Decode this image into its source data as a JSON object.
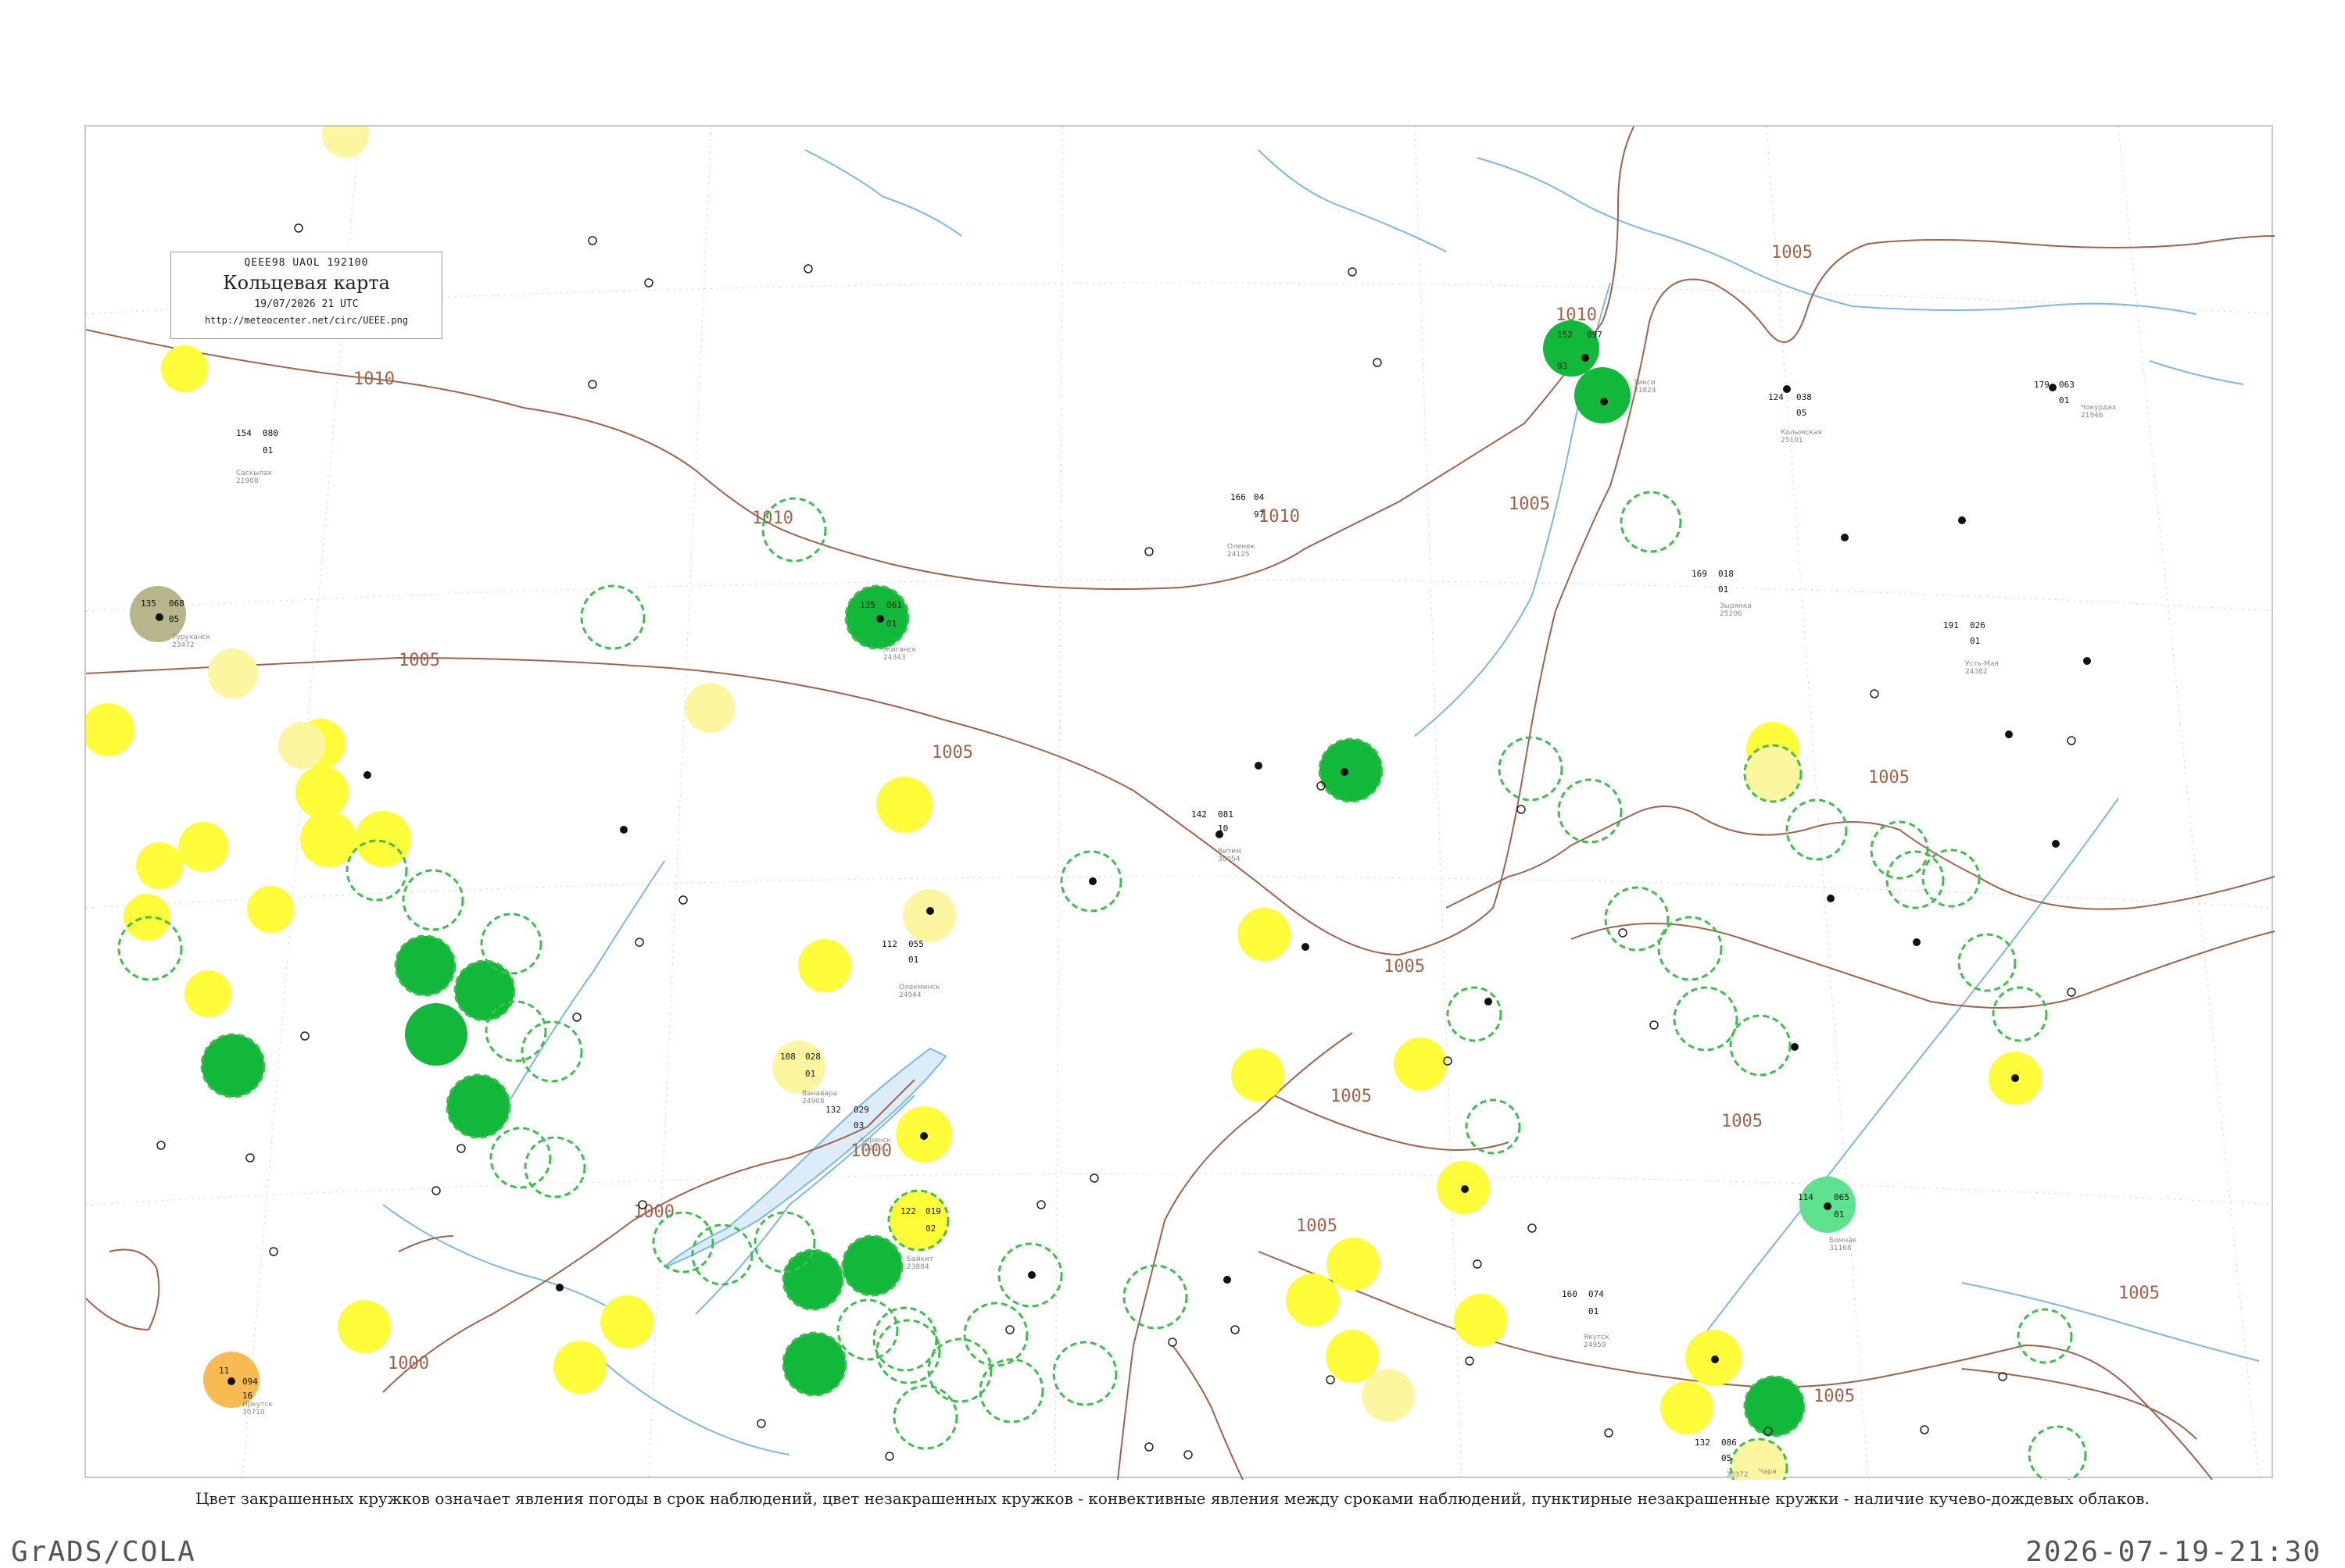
{
  "header": {
    "code": "QEEE98  UAOL  192100",
    "title": "Кольцевая карта",
    "datetime": "19/07/2026 21 UTC",
    "url": "http://meteocenter.net/circ/UEEE.png"
  },
  "caption": "Цвет закрашенных кружков означает явления погоды в срок наблюдений, цвет незакрашенных кружков - конвективные явления между сроками наблюдений, пунктирные незакрашенные кружки - наличие кучево-дождевых облаков.",
  "footer": {
    "left": "GrADS/COLA",
    "right": "2026-07-19-21:30"
  },
  "colors": {
    "isobar": "#a0624a",
    "river": "#7ab8e8",
    "rain_green": "#11b83a",
    "light_yellow": "#fffd3a",
    "pale_yellow": "#fdf6a0",
    "haze_orange": "#f7bb52",
    "mint": "#5ee28e",
    "olive": "#b6b68a",
    "cb_dashed": "#3cbf4c"
  },
  "isobars": [
    {
      "label": "1010"
    },
    {
      "label": "1005"
    },
    {
      "label": "1000"
    }
  ],
  "stations": [
    {
      "t": "152",
      "p": "097",
      "td": "03",
      "name": "Тикси",
      "id": "21824",
      "fill": "green"
    },
    {
      "t": "154",
      "p": "080",
      "td": "01",
      "name": "Саскылах",
      "id": "21908",
      "fill": "none"
    },
    {
      "t": "166",
      "p": "04",
      "td": "97",
      "name": "Оленек",
      "id": "24125",
      "fill": "cb"
    },
    {
      "t": "135",
      "p": "061",
      "td": "01",
      "name": "Жиганск",
      "id": "24343",
      "fill": "green"
    },
    {
      "t": "122",
      "p": "019",
      "td": "02",
      "name": "Байкит",
      "id": "23884",
      "fill": "yellow"
    },
    {
      "t": "108",
      "p": "028",
      "td": "01",
      "name": "Ванавара",
      "id": "24908",
      "fill": "pale"
    },
    {
      "t": "132",
      "p": "029",
      "td": "03",
      "name": "Киренск",
      "id": "30230",
      "fill": "cb"
    },
    {
      "t": "142",
      "p": "081",
      "td": "10",
      "name": "Витим",
      "id": "30054",
      "fill": "none"
    },
    {
      "t": "112",
      "p": "055",
      "td": "01",
      "name": "Олекминск",
      "id": "24944",
      "fill": "yellow"
    },
    {
      "t": "160",
      "p": "074",
      "td": "01",
      "name": "Якутск",
      "id": "24959",
      "fill": "yellow"
    },
    {
      "t": "114",
      "p": "065",
      "td": "01",
      "name": "Бомнак",
      "id": "31168",
      "fill": "mint"
    },
    {
      "t": "11",
      "p": "094",
      "td": "16",
      "name": "Иркутск",
      "id": "30710",
      "fill": "orange"
    },
    {
      "t": "135",
      "p": "068",
      "td": "05",
      "name": "Туруханск",
      "id": "23472",
      "fill": "olive"
    },
    {
      "t": "179",
      "p": "063",
      "td": "01",
      "name": "Чокурдах",
      "id": "21946",
      "fill": "none"
    },
    {
      "t": "124",
      "p": "038",
      "td": "05",
      "name": "Колымская",
      "id": "25101",
      "fill": "none"
    },
    {
      "t": "169",
      "p": "018",
      "td": "01",
      "name": "Зырянка",
      "id": "25206",
      "fill": "cb"
    },
    {
      "t": "191",
      "p": "026",
      "td": "01",
      "name": "Усть-Мая",
      "id": "24382",
      "fill": "none"
    },
    {
      "t": "132",
      "p": "086",
      "td": "05",
      "name": "Чара",
      "id": "30372",
      "fill": "pale"
    }
  ]
}
